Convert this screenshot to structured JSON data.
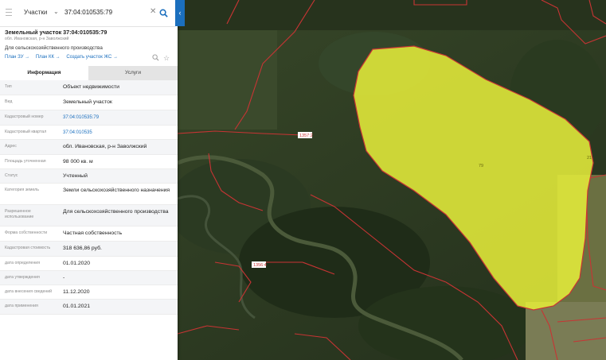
{
  "search": {
    "category": "Участки",
    "query": "37:04:010535:79"
  },
  "parcel": {
    "title": "Земельный участок 37:04:010535:79",
    "address_short": "обл. Ивановская, р-н Заволжский",
    "purpose": "Для сельскохозяйственного производства",
    "links": [
      "План ЗУ →",
      "План КК →",
      "Создать участок ЖС →"
    ]
  },
  "tabs": [
    "Информация",
    "Услуги"
  ],
  "rows": [
    {
      "key": "Тип",
      "value": "Объект недвижимости"
    },
    {
      "key": "Вид",
      "value": "Земельный участок"
    },
    {
      "key": "Кадастровый номер",
      "value": "37:04:010535:79"
    },
    {
      "key": "Кадастровый квартал",
      "value": "37:04:010535"
    },
    {
      "key": "Адрес",
      "value": "обл. Ивановская, р-н Заволжский"
    },
    {
      "key": "Площадь уточненная",
      "value": "98 000 кв. м"
    },
    {
      "key": "Статус",
      "value": "Учтенный"
    },
    {
      "key": "Категория земель",
      "value": "Земли сельскохозяйственного назначения"
    },
    {
      "key": "Разрешенное использование",
      "value": "Для сельскохозяйственного производства"
    },
    {
      "key": "Форма собственности",
      "value": "Частная собственность"
    },
    {
      "key": "Кадастровая стоимость",
      "value": "318 636,86 руб."
    },
    {
      "key": "дата определения",
      "value": "01.01.2020"
    },
    {
      "key": "дата утверждения",
      "value": "-"
    },
    {
      "key": "дата внесения сведений",
      "value": "11.12.2020"
    },
    {
      "key": "дата применения",
      "value": "01.01.2021"
    }
  ],
  "map_labels": [
    "1357:2",
    "79",
    "1356:4",
    "21"
  ],
  "colors": {
    "accent": "#1b6fbe",
    "parcel_fill": "#e4ec3a",
    "boundary": "#d23a3a"
  },
  "icons": [
    "menu-icon",
    "chevron-down-icon",
    "close-icon",
    "search-icon",
    "collapse-arrow-icon",
    "zoom-icon",
    "star-icon"
  ]
}
